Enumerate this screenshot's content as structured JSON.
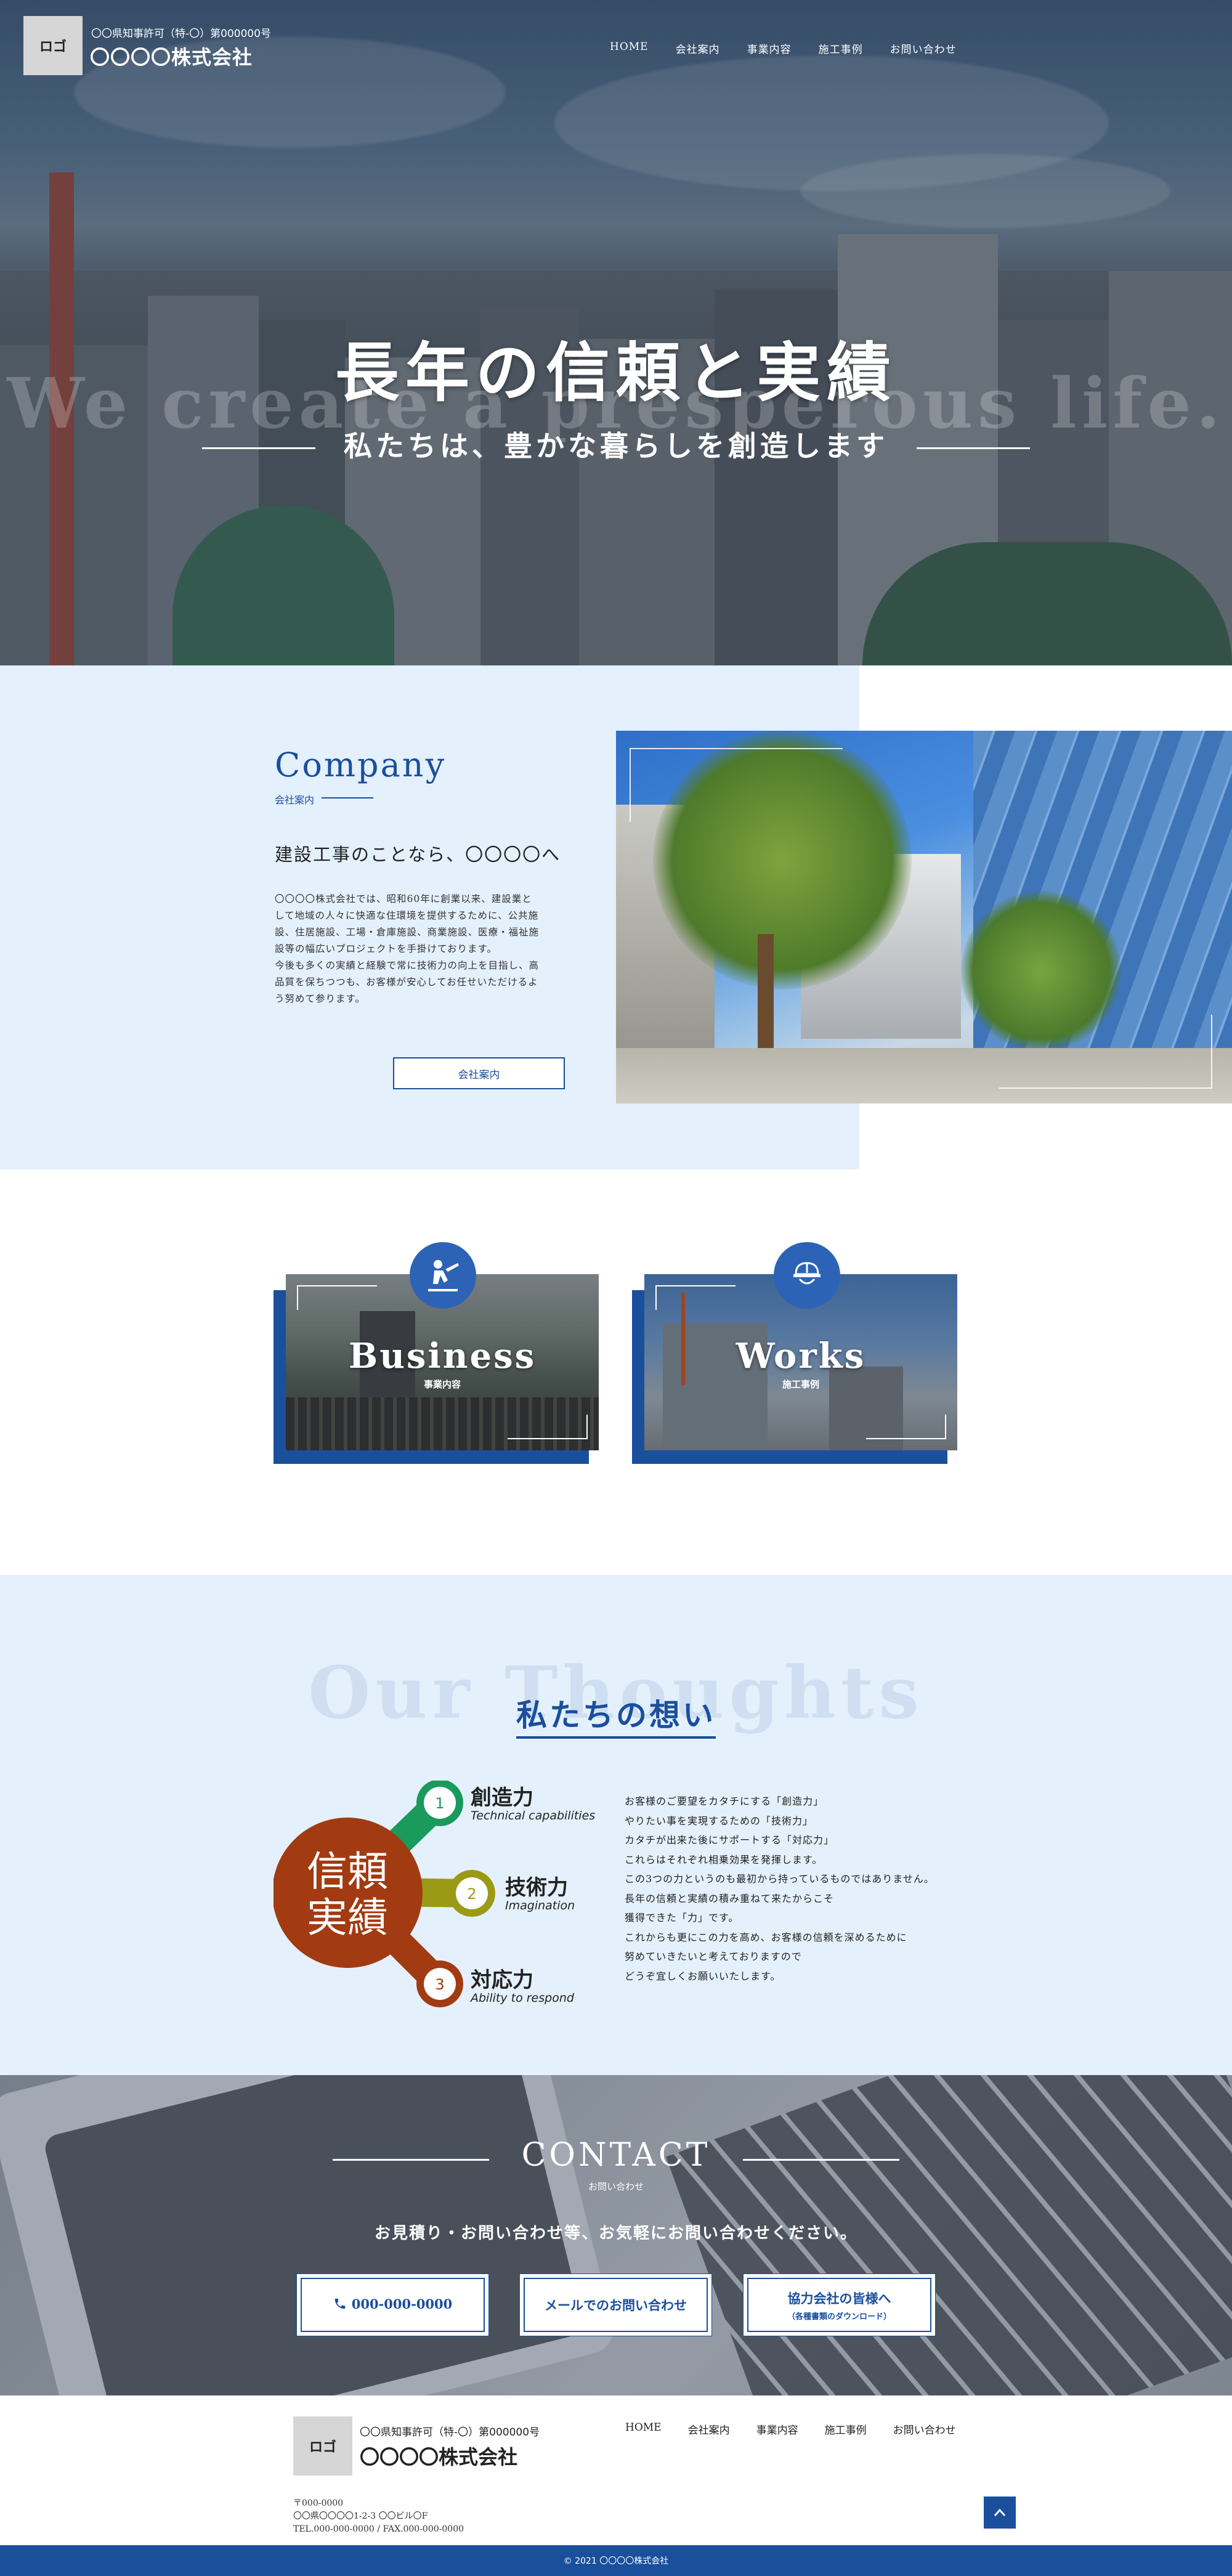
{
  "header": {
    "logo": "ロゴ",
    "permit": "〇〇県知事許可（特-〇）第000000号",
    "company": "〇〇〇〇株式会社",
    "nav": [
      "HOME",
      "会社案内",
      "事業内容",
      "施工事例",
      "お問い合わせ"
    ]
  },
  "hero": {
    "bg_text": "We create a presperous life.",
    "title": "長年の信頼と実績",
    "subtitle": "私たちは、豊かな暮らしを創造します"
  },
  "company": {
    "title_en": "Company",
    "title_jp": "会社案内",
    "heading": "建設工事のことなら、〇〇〇〇へ",
    "body": [
      "〇〇〇〇株式会社では、昭和60年に創業以来、建設業と",
      "して地域の人々に快適な住環境を提供するために、公共施",
      "設、住居施設、工場・倉庫施設、商業施設、医療・福祉施",
      "設等の幅広いプロジェクトを手掛けております。",
      "今後も多くの実績と経験で常に技術力の向上を目指し、高",
      "品質を保ちつつも、お客様が安心してお任せいただけるよ",
      "う努めて参ります。"
    ],
    "button": "会社案内"
  },
  "cards": [
    {
      "title": "Business",
      "sub": "事業内容",
      "icon": "worker-icon"
    },
    {
      "title": "Works",
      "sub": "施工事例",
      "icon": "helmet-icon"
    }
  ],
  "thoughts": {
    "bg_text": "Our Thoughts",
    "title": "私たちの想い",
    "center": [
      "信頼",
      "実績"
    ],
    "powers": [
      {
        "num": "1",
        "title": "創造力",
        "sub": "Technical capabilities",
        "color": "#1a9a5c"
      },
      {
        "num": "2",
        "title": "技術力",
        "sub": "Imagination",
        "color": "#9a9a16"
      },
      {
        "num": "3",
        "title": "対応力",
        "sub": "Ability to respond",
        "color": "#a23a12"
      }
    ],
    "center_color": "#a23a12",
    "body": [
      "お客様のご要望をカタチにする「創造力」",
      "やりたい事を実現するための「技術力」",
      "カタチが出来た後にサポートする「対応力」",
      "これらはそれぞれ相乗効果を発揮します。",
      "この3つの力というのも最初から持っているものではありません。",
      "長年の信頼と実績の積み重ねて来たからこそ",
      "獲得できた「力」です。",
      "これからも更にこの力を高め、お客様の信頼を深めるために",
      "努めていきたいと考えておりますので",
      "どうぞ宜しくお願いいたします。"
    ]
  },
  "contact": {
    "title": "CONTACT",
    "title_jp": "お問い合わせ",
    "message": "お見積り・お問い合わせ等、お気軽にお問い合わせください。",
    "buttons": [
      {
        "label": "000-000-0000",
        "icon": "phone-icon"
      },
      {
        "label": "メールでのお問い合わせ"
      },
      {
        "label": "協力会社の皆様へ",
        "small": "（各種書類のダウンロード）"
      }
    ]
  },
  "footer": {
    "logo": "ロゴ",
    "permit": "〇〇県知事許可（特-〇）第000000号",
    "company": "〇〇〇〇株式会社",
    "nav": [
      "HOME",
      "会社案内",
      "事業内容",
      "施工事例",
      "お問い合わせ"
    ],
    "address": [
      "〒000-0000",
      "〇〇県〇〇〇〇1-2-3 〇〇ビル〇F",
      "TEL.000-000-0000 / FAX.000-000-0000"
    ],
    "copyright": "© 2021 〇〇〇〇株式会社"
  },
  "colors": {
    "primary": "#1a4f9c",
    "light_bg": "#e4f0fb"
  }
}
